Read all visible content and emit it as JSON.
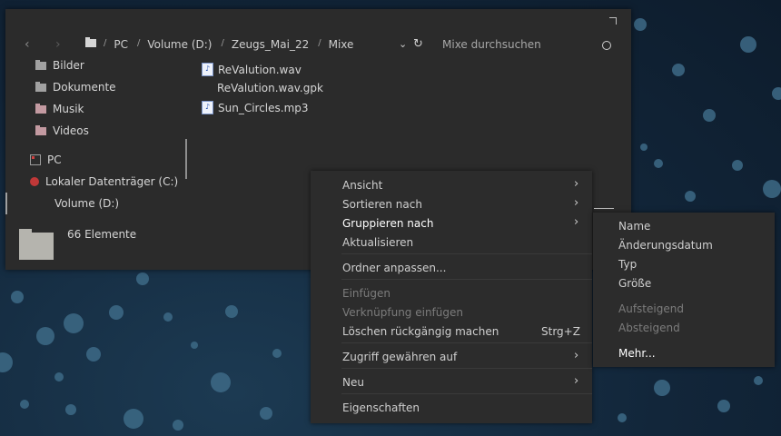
{
  "addressbar": {
    "crumbs": [
      "PC",
      "Volume (D:)",
      "Zeugs_Mai_22",
      "Mixe"
    ],
    "search_placeholder": "Mixe durchsuchen",
    "back": "‹",
    "forward": "›",
    "chevron": "⌄",
    "refresh": "↻",
    "separator": "/"
  },
  "sidebar": {
    "items": [
      "Bilder",
      "Dokumente",
      "Musik",
      "Videos",
      "PC",
      "Lokaler Datenträger (C:)",
      "Volume (D:)"
    ]
  },
  "files": [
    "ReValution.wav",
    "ReValution.wav.gpk",
    "Sun_Circles.mp3"
  ],
  "status": {
    "count": "66 Elemente"
  },
  "context_menu": {
    "items": [
      "Ansicht",
      "Sortieren nach",
      "Gruppieren nach",
      "Aktualisieren",
      "Ordner anpassen...",
      "Einfügen",
      "Verknüpfung einfügen",
      "Löschen rückgängig machen",
      "Zugriff gewähren auf",
      "Neu",
      "Eigenschaften"
    ],
    "shortcut_undo": "Strg+Z",
    "arrow": "›"
  },
  "submenu": {
    "items": [
      "Name",
      "Änderungsdatum",
      "Typ",
      "Größe",
      "Aufsteigend",
      "Absteigend",
      "Mehr..."
    ]
  },
  "icons": {
    "audio": "♪"
  }
}
